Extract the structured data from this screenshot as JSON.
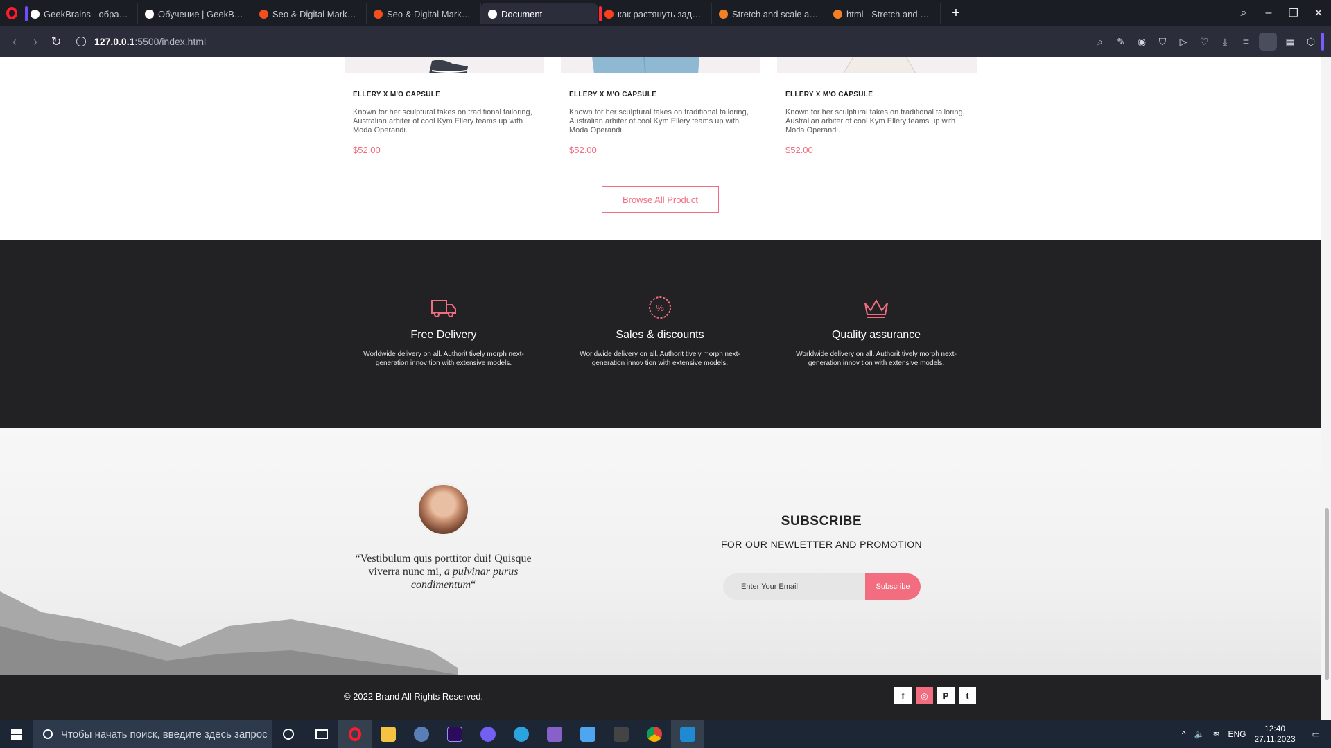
{
  "browser": {
    "tabs": [
      {
        "title": "GeekBrains - образовате",
        "color": "#ffffff",
        "marker": "#6e4cff"
      },
      {
        "title": "Обучение | GeekBrains - с",
        "color": "#ffffff",
        "marker": ""
      },
      {
        "title": "Seo & Digital Marketing L",
        "color": "#f24e1e",
        "marker": ""
      },
      {
        "title": "Seo & Digital Marketing L",
        "color": "#f24e1e",
        "marker": ""
      },
      {
        "title": "Document",
        "color": "#ffffff",
        "marker": ""
      },
      {
        "title": "как растянуть задний фо",
        "color": "#fc3f1d",
        "marker": "#ff2b3d"
      },
      {
        "title": "Stretch and scale a CSS im",
        "color": "#f48024",
        "marker": ""
      },
      {
        "title": "html - Stretch and scale C",
        "color": "#f48024",
        "marker": ""
      }
    ],
    "active_tab": 4,
    "url_host": "127.0.0.1",
    "url_rest": ":5500/index.html"
  },
  "products": [
    {
      "title": "ELLERY X M'O CAPSULE",
      "description": "Known for her sculptural takes on traditional tailoring, Australian arbiter of cool Kym Ellery teams up with Moda Operandi.",
      "price": "$52.00"
    },
    {
      "title": "ELLERY X M'O CAPSULE",
      "description": "Known for her sculptural takes on traditional tailoring, Australian arbiter of cool Kym Ellery teams up with Moda Operandi.",
      "price": "$52.00"
    },
    {
      "title": "ELLERY X M'O CAPSULE",
      "description": "Known for her sculptural takes on traditional tailoring, Australian arbiter of cool Kym Ellery teams up with Moda Operandi.",
      "price": "$52.00"
    }
  ],
  "browse_label": "Browse All Product",
  "features": [
    {
      "icon": "truck-icon",
      "title": "Free Delivery",
      "text": "Worldwide delivery on all. Authorit tively morph next-generation innov tion with extensive models."
    },
    {
      "icon": "discount-icon",
      "title": "Sales & discounts",
      "text": "Worldwide delivery on all. Authorit tively morph next-generation innov tion with extensive models."
    },
    {
      "icon": "crown-icon",
      "title": "Quality assurance",
      "text": "Worldwide delivery on all. Authorit tively morph next-generation innov tion with extensive models."
    }
  ],
  "testimonial": {
    "quote_open": "“",
    "quote_plain": "Vestibulum quis porttitor dui! Quisque viverra nunc mi, ",
    "quote_italic": "a pulvinar purus condimentum",
    "quote_close": "“"
  },
  "subscribe": {
    "title": "SUBSCRIBE",
    "subtitle": "FOR OUR NEWLETTER AND PROMOTION",
    "placeholder": "Enter Your Email",
    "button": "Subscribe"
  },
  "footer": {
    "copyright": "© 2022 Brand All Rights Reserved.",
    "socials": [
      "f",
      "◎",
      "P",
      "t"
    ]
  },
  "colors": {
    "accent": "#f16d7f",
    "dark": "#222224"
  },
  "taskbar": {
    "search_placeholder": "Чтобы начать поиск, введите здесь запрос",
    "lang": "ENG",
    "time": "12:40",
    "date": "27.11.2023"
  }
}
